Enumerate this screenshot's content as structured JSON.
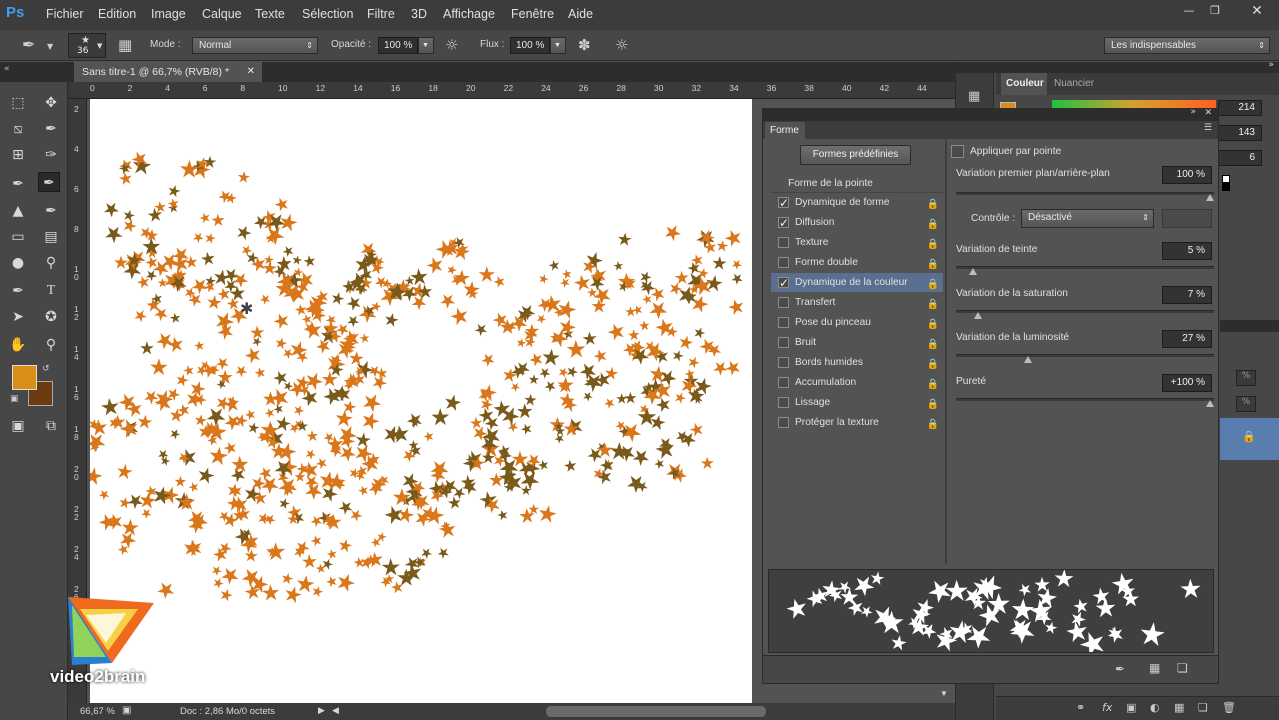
{
  "app": {
    "logo": "Ps"
  },
  "menu": [
    "Fichier",
    "Edition",
    "Image",
    "Calque",
    "Texte",
    "Sélection",
    "Filtre",
    "3D",
    "Affichage",
    "Fenêtre",
    "Aide"
  ],
  "options": {
    "brush_size": "36",
    "mode_label": "Mode :",
    "mode_value": "Normal",
    "opacity_label": "Opacité :",
    "opacity_value": "100 %",
    "flux_label": "Flux :",
    "flux_value": "100 %",
    "workspace": "Les indispensables"
  },
  "document": {
    "tab_title": "Sans titre-1 @ 66,7% (RVB/8) *",
    "ruler_top": [
      "0",
      "2",
      "4",
      "6",
      "8",
      "10",
      "12",
      "14",
      "16",
      "18",
      "20",
      "22",
      "24",
      "26",
      "28",
      "30",
      "32",
      "34",
      "36",
      "38",
      "40",
      "42",
      "44"
    ],
    "ruler_left": [
      "2",
      "4",
      "6",
      "8",
      "10",
      "12",
      "14",
      "16",
      "18",
      "20",
      "22",
      "24",
      "26"
    ]
  },
  "status": {
    "zoom": "66,67 %",
    "doc": "Doc : 2,86 Mo/0 octets"
  },
  "colors": {
    "foreground": "#d98f17",
    "background": "#6b3a10",
    "leaf_a": "#d9771a",
    "leaf_b": "#7a5a1a",
    "accent_blue": "#5a7db0"
  },
  "color_panel": {
    "tab_active": "Couleur",
    "tab_other": "Nuancier",
    "r": "214",
    "g": "143",
    "b": "6"
  },
  "brush_panel": {
    "tab": "Forme",
    "presets_button": "Formes prédéfinies",
    "tip_header": "Forme de la pointe",
    "items": [
      {
        "label": "Dynamique de forme",
        "checked": true
      },
      {
        "label": "Diffusion",
        "checked": true
      },
      {
        "label": "Texture",
        "checked": false
      },
      {
        "label": "Forme double",
        "checked": false
      },
      {
        "label": "Dynamique de la couleur",
        "checked": true,
        "selected": true
      },
      {
        "label": "Transfert",
        "checked": false
      },
      {
        "label": "Pose du pinceau",
        "checked": false
      },
      {
        "label": "Bruit",
        "checked": false
      },
      {
        "label": "Bords humides",
        "checked": false
      },
      {
        "label": "Accumulation",
        "checked": false
      },
      {
        "label": "Lissage",
        "checked": false
      },
      {
        "label": "Protéger la texture",
        "checked": false
      }
    ],
    "apply_per_tip": "Appliquer par pointe",
    "settings": {
      "fg_bg_label": "Variation premier plan/arrière-plan",
      "fg_bg_value": "100 %",
      "fg_bg_level": 1.0,
      "control_label": "Contrôle :",
      "control_value": "Désactivé",
      "hue_label": "Variation de teinte",
      "hue_value": "5 %",
      "hue_level": 0.05,
      "sat_label": "Variation de la saturation",
      "sat_value": "7 %",
      "sat_level": 0.07,
      "lum_label": "Variation de la luminosité",
      "lum_value": "27 %",
      "lum_level": 0.27,
      "purity_label": "Pureté",
      "purity_value": "+100 %",
      "purity_level": 1.0
    }
  },
  "watermark": {
    "text": "video2brain"
  }
}
